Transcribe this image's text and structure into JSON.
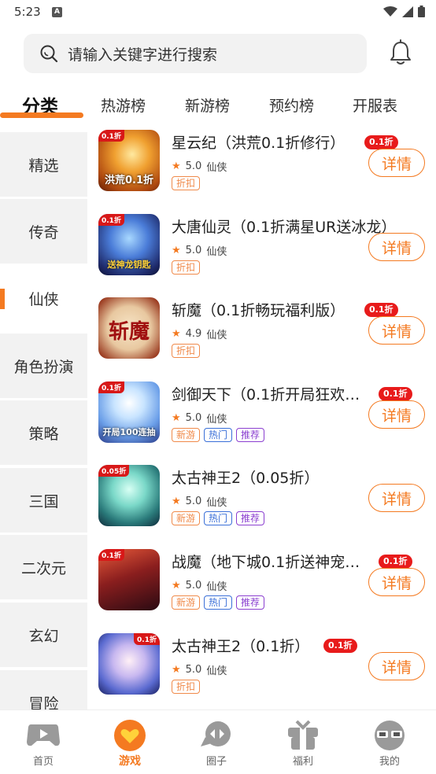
{
  "status": {
    "time": "5:23",
    "notif_letter": "A"
  },
  "search": {
    "placeholder": "请输入关键字进行搜索"
  },
  "top_tabs": [
    "分类",
    "热游榜",
    "新游榜",
    "预约榜",
    "开服表"
  ],
  "categories": [
    "精选",
    "传奇",
    "仙侠",
    "角色扮演",
    "策略",
    "三国",
    "二次元",
    "玄幻",
    "冒险"
  ],
  "active_category": "仙侠",
  "games": [
    {
      "title": "星云纪（洪荒0.1折修行）",
      "discount": "0.1折",
      "rating": "5.0",
      "genre": "仙侠",
      "icon_badge": "0.1折",
      "icon_caption": "洪荒0.1折",
      "tags": [
        {
          "text": "折扣",
          "color": "orange"
        }
      ],
      "detail": "详情"
    },
    {
      "title": "大唐仙灵（0.1折满星UR送冰龙）",
      "discount": "",
      "rating": "5.0",
      "genre": "仙侠",
      "icon_badge": "0.1折",
      "icon_caption": "送神龙钥匙",
      "tags": [
        {
          "text": "折扣",
          "color": "orange"
        }
      ],
      "detail": "详情"
    },
    {
      "title": "斩魔（0.1折畅玩福利版）",
      "discount": "0.1折",
      "rating": "4.9",
      "genre": "仙侠",
      "icon_badge": "",
      "icon_caption": "斩魔",
      "tags": [
        {
          "text": "折扣",
          "color": "orange"
        }
      ],
      "detail": "详情"
    },
    {
      "title": "剑御天下（0.1折开局狂欢…",
      "discount": "0.1折",
      "rating": "5.0",
      "genre": "仙侠",
      "icon_badge": "0.1折",
      "icon_caption": "开局100连抽",
      "tags": [
        {
          "text": "新游",
          "color": "orange"
        },
        {
          "text": "热门",
          "color": "blue"
        },
        {
          "text": "推荐",
          "color": "purple"
        }
      ],
      "detail": "详情"
    },
    {
      "title": "太古神王2（0.05折）",
      "discount": "",
      "rating": "5.0",
      "genre": "仙侠",
      "icon_badge": "0.05折",
      "icon_caption": "",
      "tags": [
        {
          "text": "新游",
          "color": "orange"
        },
        {
          "text": "热门",
          "color": "blue"
        },
        {
          "text": "推荐",
          "color": "purple"
        }
      ],
      "detail": "详情"
    },
    {
      "title": "战魔（地下城0.1折送神宠…",
      "discount": "0.1折",
      "rating": "5.0",
      "genre": "仙侠",
      "icon_badge": "0.1折",
      "icon_caption": "",
      "tags": [
        {
          "text": "新游",
          "color": "orange"
        },
        {
          "text": "热门",
          "color": "blue"
        },
        {
          "text": "推荐",
          "color": "purple"
        }
      ],
      "detail": "详情"
    },
    {
      "title": "太古神王2（0.1折）",
      "discount": "0.1折",
      "rating": "5.0",
      "genre": "仙侠",
      "icon_badge": "0.1折",
      "icon_caption": "",
      "tags": [
        {
          "text": "折扣",
          "color": "orange"
        }
      ],
      "detail": "详情"
    }
  ],
  "bottom_nav": [
    {
      "label": "首页",
      "icon": "gamepad-icon"
    },
    {
      "label": "游戏",
      "icon": "heart-chat-icon"
    },
    {
      "label": "圈子",
      "icon": "chat-bubble-icon"
    },
    {
      "label": "福利",
      "icon": "gift-icon"
    },
    {
      "label": "我的",
      "icon": "sunglasses-face-icon"
    }
  ],
  "active_nav": "游戏",
  "colors": {
    "accent": "#f47a21",
    "discount_red": "#e81b1b",
    "tag_orange": "#f08a4a",
    "tag_blue": "#3a6fd8",
    "tag_purple": "#8b3fd0"
  }
}
